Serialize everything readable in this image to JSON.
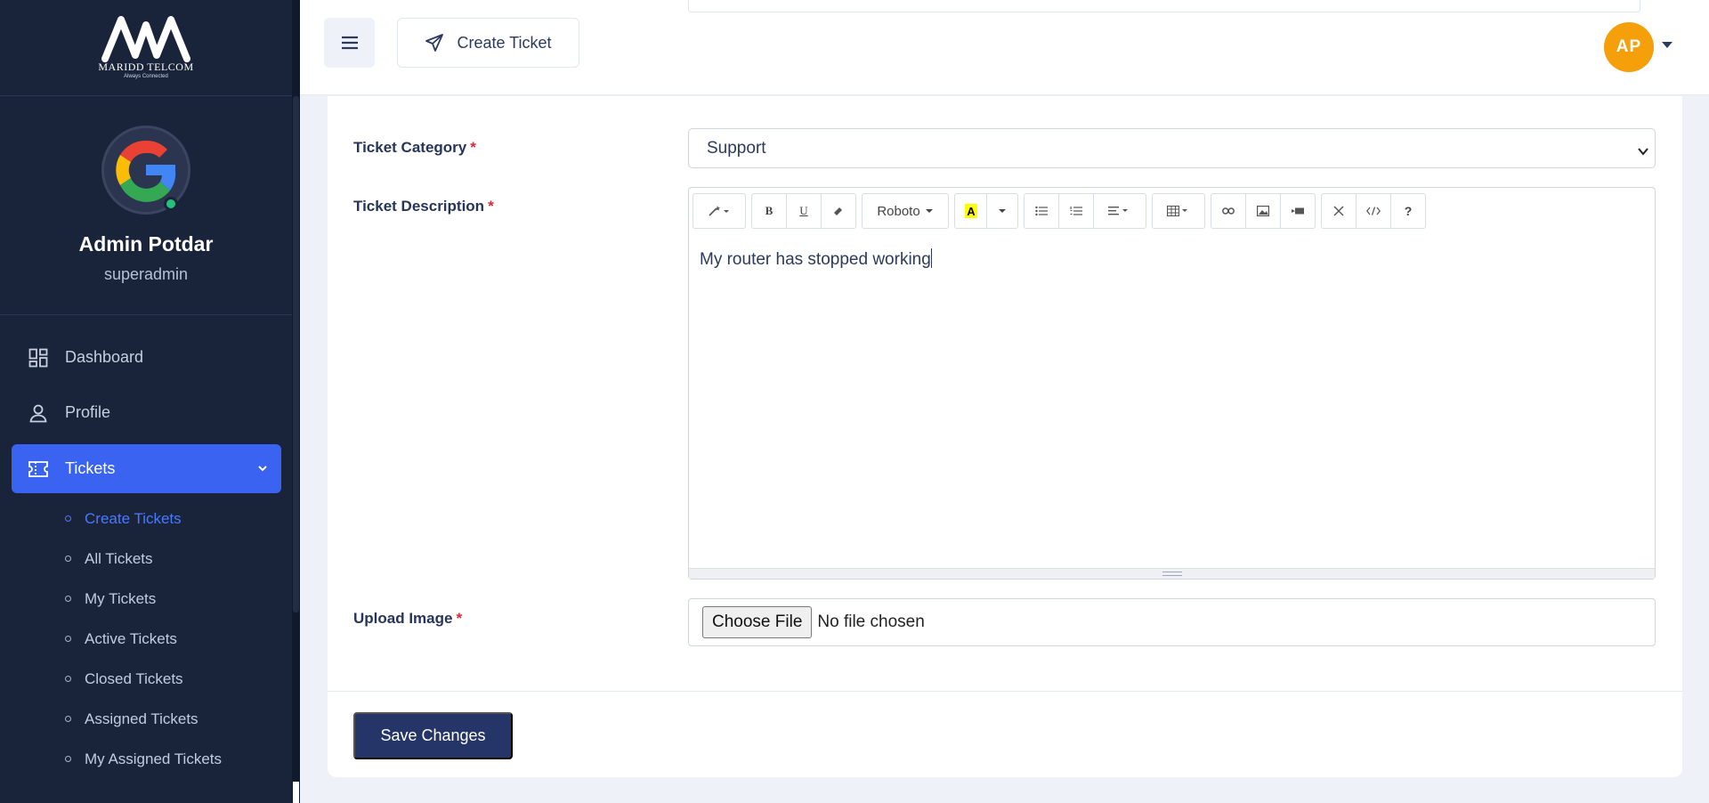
{
  "brand": {
    "name": "MARIDD TELCOM",
    "tagline": "Always Connected"
  },
  "user": {
    "name": "Admin Potdar",
    "role": "superadmin",
    "initials": "AP"
  },
  "sidebar": {
    "items": [
      {
        "label": "Dashboard",
        "icon": "dashboard-icon"
      },
      {
        "label": "Profile",
        "icon": "user-icon"
      },
      {
        "label": "Tickets",
        "icon": "ticket-icon"
      }
    ],
    "ticket_submenu": [
      "Create Tickets",
      "All Tickets",
      "My Tickets",
      "Active Tickets",
      "Closed Tickets",
      "Assigned Tickets",
      "My Assigned Tickets"
    ],
    "active_item": "Tickets",
    "active_subitem": "Create Tickets"
  },
  "topbar": {
    "create_label": "Create Ticket"
  },
  "form": {
    "category_label": "Ticket Category",
    "category_value": "Support",
    "description_label": "Ticket Description",
    "description_value": "My router has stopped working",
    "font_name": "Roboto",
    "upload_label": "Upload Image",
    "choose_file_label": "Choose File",
    "no_file_text": "No file chosen",
    "required_mark": "*",
    "save_label": "Save Changes"
  },
  "colors": {
    "sidebar_bg": "#19243a",
    "accent": "#3a63f2",
    "avatar_bg": "#f59f0b",
    "save_button": "#253567",
    "required": "#e0273b",
    "online": "#23c17a"
  }
}
